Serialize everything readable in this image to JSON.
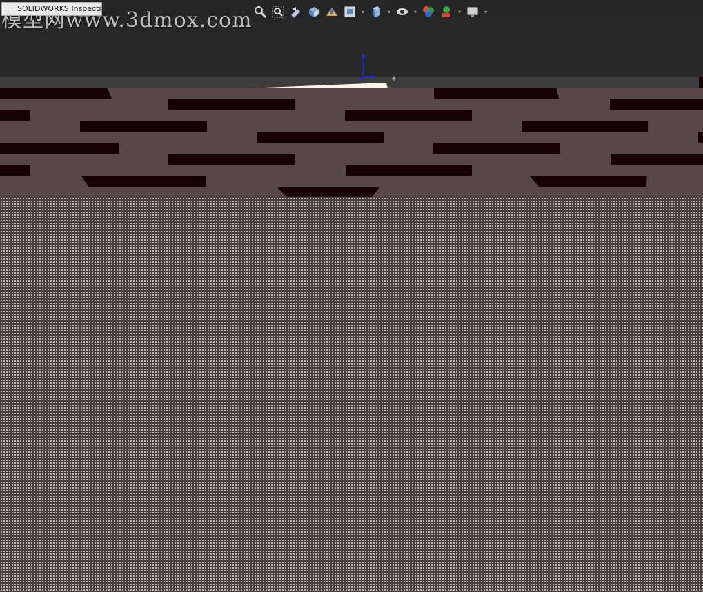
{
  "document_tab": {
    "label": "SOLIDWORKS Inspection"
  },
  "watermark": {
    "text": "模型网www.3dmox.com"
  },
  "heads_up_toolbar": {
    "tools": [
      {
        "name": "zoom-to-fit-icon"
      },
      {
        "name": "zoom-to-area-icon"
      },
      {
        "name": "previous-view-icon"
      },
      {
        "name": "section-view-icon"
      },
      {
        "name": "dynamic-annotation-icon"
      },
      {
        "name": "view-orientation-icon"
      },
      {
        "name": "display-style-icon"
      },
      {
        "name": "hide-show-items-icon"
      },
      {
        "name": "edit-appearance-icon"
      },
      {
        "name": "apply-scene-icon"
      },
      {
        "name": "view-settings-icon"
      }
    ]
  },
  "colors": {
    "viewport_bg": "#2e2e2e",
    "wall": "#574846",
    "brick": "#180002",
    "dot_fill": "#d9d2cf",
    "triad_blue": "#1f2bd6"
  }
}
